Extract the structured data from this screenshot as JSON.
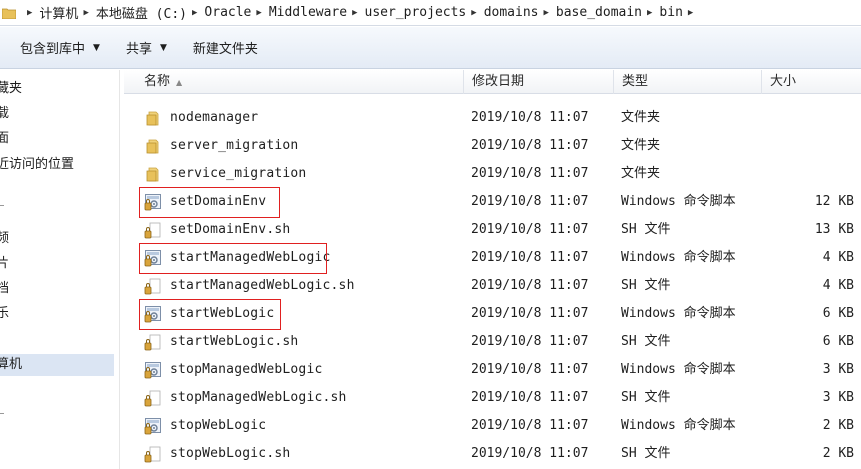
{
  "address_bar": {
    "crumbs": [
      "计算机",
      "本地磁盘 (C:)",
      "Oracle",
      "Middleware",
      "user_projects",
      "domains",
      "base_domain",
      "bin"
    ]
  },
  "toolbar": {
    "include_in_library": "包含到库中",
    "share": "共享",
    "new_folder": "新建文件夹"
  },
  "sidebar": {
    "items": [
      {
        "label": "藏夹",
        "selected": false
      },
      {
        "label": "载",
        "selected": false
      },
      {
        "label": "面",
        "selected": false
      },
      {
        "label": "近访问的位置",
        "selected": false
      },
      {
        "label": "频",
        "selected": false
      },
      {
        "label": "片",
        "selected": false
      },
      {
        "label": "档",
        "selected": false
      },
      {
        "label": "乐",
        "selected": false
      },
      {
        "label": "算机",
        "selected": true
      }
    ]
  },
  "columns": {
    "name": "名称",
    "date": "修改日期",
    "type": "类型",
    "size": "大小"
  },
  "files": [
    {
      "name": "nodemanager",
      "date": "2019/10/8 11:07",
      "type": "文件夹",
      "size": "",
      "icon": "folder-icon",
      "highlighted": false
    },
    {
      "name": "server_migration",
      "date": "2019/10/8 11:07",
      "type": "文件夹",
      "size": "",
      "icon": "folder-icon",
      "highlighted": false
    },
    {
      "name": "service_migration",
      "date": "2019/10/8 11:07",
      "type": "文件夹",
      "size": "",
      "icon": "folder-icon",
      "highlighted": false
    },
    {
      "name": "setDomainEnv",
      "date": "2019/10/8 11:07",
      "type": "Windows 命令脚本",
      "size": "12 KB",
      "icon": "batch-script-icon",
      "highlighted": true
    },
    {
      "name": "setDomainEnv.sh",
      "date": "2019/10/8 11:07",
      "type": "SH 文件",
      "size": "13 KB",
      "icon": "sh-file-icon",
      "highlighted": false
    },
    {
      "name": "startManagedWebLogic",
      "date": "2019/10/8 11:07",
      "type": "Windows 命令脚本",
      "size": "4 KB",
      "icon": "batch-script-icon",
      "highlighted": true
    },
    {
      "name": "startManagedWebLogic.sh",
      "date": "2019/10/8 11:07",
      "type": "SH 文件",
      "size": "4 KB",
      "icon": "sh-file-icon",
      "highlighted": false
    },
    {
      "name": "startWebLogic",
      "date": "2019/10/8 11:07",
      "type": "Windows 命令脚本",
      "size": "6 KB",
      "icon": "batch-script-icon",
      "highlighted": true
    },
    {
      "name": "startWebLogic.sh",
      "date": "2019/10/8 11:07",
      "type": "SH 文件",
      "size": "6 KB",
      "icon": "sh-file-icon",
      "highlighted": false
    },
    {
      "name": "stopManagedWebLogic",
      "date": "2019/10/8 11:07",
      "type": "Windows 命令脚本",
      "size": "3 KB",
      "icon": "batch-script-icon",
      "highlighted": false
    },
    {
      "name": "stopManagedWebLogic.sh",
      "date": "2019/10/8 11:07",
      "type": "SH 文件",
      "size": "3 KB",
      "icon": "sh-file-icon",
      "highlighted": false
    },
    {
      "name": "stopWebLogic",
      "date": "2019/10/8 11:07",
      "type": "Windows 命令脚本",
      "size": "2 KB",
      "icon": "batch-script-icon",
      "highlighted": false
    },
    {
      "name": "stopWebLogic.sh",
      "date": "2019/10/8 11:07",
      "type": "SH 文件",
      "size": "2 KB",
      "icon": "sh-file-icon",
      "highlighted": false
    }
  ],
  "colors": {
    "highlight_box": "#e02020",
    "folder_yellow": "#e8c15a",
    "selection_blue": "#dbe5f3"
  }
}
